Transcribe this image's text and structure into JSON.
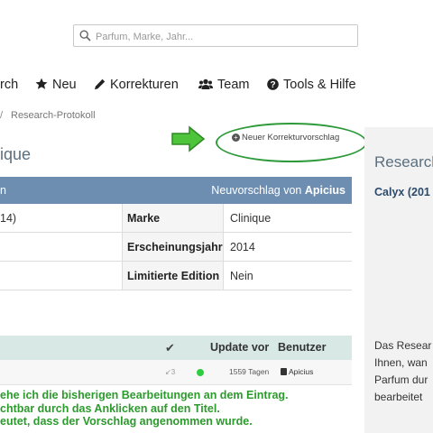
{
  "search": {
    "placeholder": "Parfum, Marke, Jahr..."
  },
  "nav": {
    "items": [
      {
        "label": "rch"
      },
      {
        "label": "Neu"
      },
      {
        "label": "Korrekturen"
      },
      {
        "label": "Team"
      },
      {
        "label": "Tools & Hilfe"
      }
    ]
  },
  "breadcrumb": {
    "separator": "/",
    "current": "Research-Protokoll"
  },
  "page": {
    "title": "ique"
  },
  "new_correction": {
    "label": "Neuer Korrekturvorschlag"
  },
  "details": {
    "header_left": "n",
    "header_right_prefix": "Neuvorschlag von",
    "header_right_user": "Apicius",
    "rows": [
      {
        "c1": "14)",
        "label": "Marke",
        "value": "Clinique"
      },
      {
        "c1": "",
        "label": "Erscheinungsjahr",
        "value": "2014"
      },
      {
        "c1": "",
        "label": "Limitierte Edition",
        "value": "Nein"
      }
    ]
  },
  "history": {
    "headers": {
      "check": "✔",
      "update": "Update vor",
      "user": "Benutzer"
    },
    "rows": [
      {
        "count": "↙3",
        "days": "1559 Tagen",
        "user": "Apicius",
        "status_color": "#2ecc40"
      }
    ]
  },
  "note_lines": [
    "ehe ich die bisherigen Bearbeitungen an dem Eintrag.",
    "chtbar durch das Anklicken auf den Titel.",
    "eutet, dass der Vorschlag angenommen wurde."
  ],
  "right_panel": {
    "title": "Research",
    "item": "Calyx (201",
    "text_lines": [
      "Das Resear",
      "Ihnen, wan",
      "Parfum dur",
      "bearbeitet"
    ]
  },
  "colors": {
    "accent_blue": "#6e8eb1",
    "history_header": "#d8e8e5",
    "annotation_green": "#2e9a3a",
    "note_green": "#2c9a2c"
  }
}
